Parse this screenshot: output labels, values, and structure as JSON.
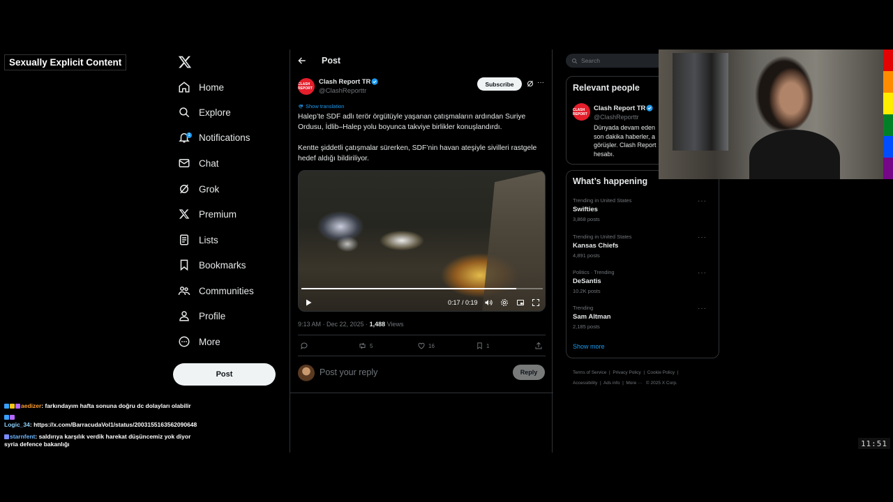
{
  "warning_label": "Sexually Explicit Content",
  "nav": {
    "items": [
      {
        "label": "Home",
        "icon": "home-icon"
      },
      {
        "label": "Explore",
        "icon": "search-icon"
      },
      {
        "label": "Notifications",
        "icon": "bell-icon",
        "badge": "1"
      },
      {
        "label": "Chat",
        "icon": "mail-icon"
      },
      {
        "label": "Grok",
        "icon": "grok-icon"
      },
      {
        "label": "Premium",
        "icon": "x-logo-icon"
      },
      {
        "label": "Lists",
        "icon": "list-icon"
      },
      {
        "label": "Bookmarks",
        "icon": "bookmark-icon"
      },
      {
        "label": "Communities",
        "icon": "communities-icon"
      },
      {
        "label": "Profile",
        "icon": "person-icon"
      },
      {
        "label": "More",
        "icon": "more-circle-icon"
      }
    ],
    "post_button": "Post"
  },
  "chat": [
    {
      "user": "aedizer",
      "message": "farkındayım hafta sonuna doğru dc dolayları olabilir"
    },
    {
      "user": "Logic_34",
      "message": "https://x.com/BarracudaVol1/status/2003155163562090648"
    },
    {
      "user": "starnfent",
      "message": "saldırıya karşılık verdik harekat düşüncemiz yok diyor syria defence bakanlığı"
    }
  ],
  "main": {
    "header": "Post",
    "author": {
      "name": "Clash Report TR",
      "handle": "@ClashReporttr",
      "avatar_text": "CLASH REPORT"
    },
    "subscribe": "Subscribe",
    "show_translation": "Show translation",
    "text_p1": "Halep’te SDF adlı terör örgütüyle yaşanan çatışmaların ardından Suriye Ordusu, İdlib–Halep yolu boyunca takviye birlikler konuşlandırdı.",
    "text_p2": "Kentte şiddetli çatışmalar sürerken, SDF’nin havan ateşiyle sivilleri rastgele hedef aldığı bildiriliyor.",
    "video": {
      "time": "0:17 / 0:19",
      "progress": 0.89
    },
    "meta": {
      "timestamp": "9:13 AM · Dec 22, 2025 · ",
      "views": "1,488",
      "views_label": " Views"
    },
    "actions": {
      "replies": "",
      "reposts": "5",
      "likes": "16",
      "bookmarks": "1"
    },
    "reply_placeholder": "Post your reply",
    "reply_button": "Reply"
  },
  "right": {
    "search_placeholder": "Search",
    "relevant_title": "Relevant people",
    "person": {
      "name": "Clash Report TR",
      "handle": "@ClashReporttr",
      "bio": "Dünyada devam eden son dakika haberler, a görüşler. Clash Report hesabı."
    },
    "whats_happening_title": "What’s happening",
    "trends": [
      {
        "context": "Trending in United States",
        "name": "Swifties",
        "count": "3,868 posts"
      },
      {
        "context": "Trending in United States",
        "name": "Kansas Chiefs",
        "count": "4,891 posts"
      },
      {
        "context": "Politics · Trending",
        "name": "DeSantis",
        "count": "10.2K posts"
      },
      {
        "context": "Trending",
        "name": "Sam Altman",
        "count": "2,185 posts"
      }
    ],
    "show_more": "Show more",
    "footer": {
      "terms": "Terms of Service",
      "privacy": "Privacy Policy",
      "cookie": "Cookie Policy",
      "accessibility": "Accessibility",
      "ads": "Ads info",
      "more": "More ···",
      "copyright": "© 2025 X Corp."
    }
  },
  "clock": "11:51",
  "colors": {
    "accent": "#1d9bf0",
    "rainbow": [
      "#e40303",
      "#ff8c00",
      "#ffed00",
      "#008026",
      "#004dff",
      "#750787"
    ]
  }
}
